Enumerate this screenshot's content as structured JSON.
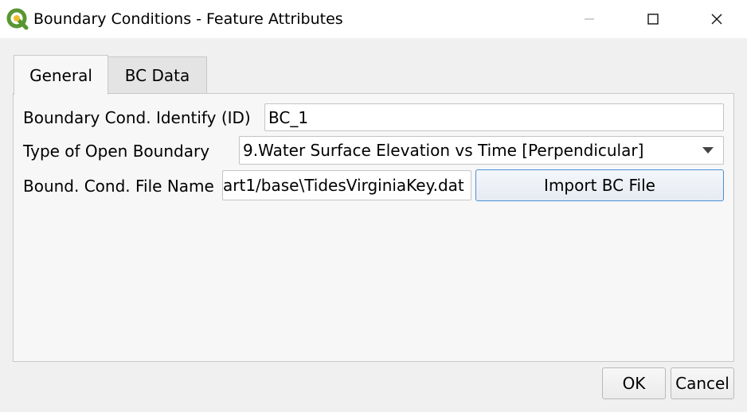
{
  "window": {
    "title": "Boundary Conditions - Feature Attributes",
    "app_icon": "qgis-logo-icon",
    "controls": [
      "minimize-icon",
      "maximize-icon",
      "close-icon"
    ]
  },
  "tabs": [
    {
      "label": "General",
      "selected": true
    },
    {
      "label": "BC Data",
      "selected": false
    }
  ],
  "form": {
    "id_label": "Boundary Cond. Identify (ID)",
    "id_value": "BC_1",
    "type_label": "Type of Open Boundary",
    "type_value": "9.Water Surface Elevation vs Time [Perpendicular]",
    "file_label": "Bound. Cond. File Name",
    "file_value": "art1/base\\TidesVirginiaKey.dat",
    "import_button": "Import BC File"
  },
  "footer": {
    "ok_label": "OK",
    "cancel_label": "Cancel"
  },
  "colors": {
    "accent_border": "#4a90d9",
    "qgis_green": "#589632",
    "qgis_yellow": "#eebc2c"
  }
}
